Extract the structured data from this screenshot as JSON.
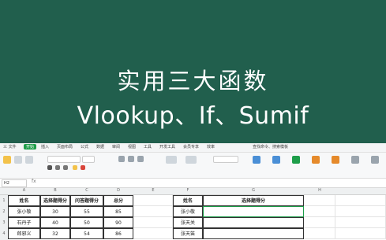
{
  "banner": {
    "title": "实用三大函数",
    "subtitle": "Vlookup、If、Sumif"
  },
  "menubar": {
    "items": [
      "三 文件",
      "开始",
      "插入",
      "页面布局",
      "公式",
      "数据",
      "审阅",
      "视图",
      "工具",
      "开发工具",
      "会员专享",
      "效率",
      "查找命令、搜索模板"
    ],
    "active_index": 1
  },
  "formula_bar": {
    "name_box": "H2",
    "fx": "fx"
  },
  "columns": [
    "A",
    "B",
    "C",
    "D",
    "E",
    "F",
    "G",
    "H"
  ],
  "table1": {
    "headers": [
      "姓名",
      "选择题得分",
      "问答题得分",
      "总分"
    ],
    "rows": [
      [
        "张小敬",
        "30",
        "55",
        "85"
      ],
      [
        "石丹子",
        "40",
        "50",
        "90"
      ],
      [
        "郎邪义",
        "32",
        "54",
        "86"
      ]
    ]
  },
  "table2": {
    "headers": [
      "姓名",
      "选择题得分"
    ],
    "rows": [
      [
        "张小敬",
        ""
      ],
      [
        "张天关",
        ""
      ],
      [
        "张天笛",
        ""
      ]
    ]
  },
  "row_numbers": [
    "1",
    "2",
    "3",
    "4"
  ],
  "colors": {
    "banner_bg": "#215f4d",
    "accent": "#1e9e4a"
  }
}
